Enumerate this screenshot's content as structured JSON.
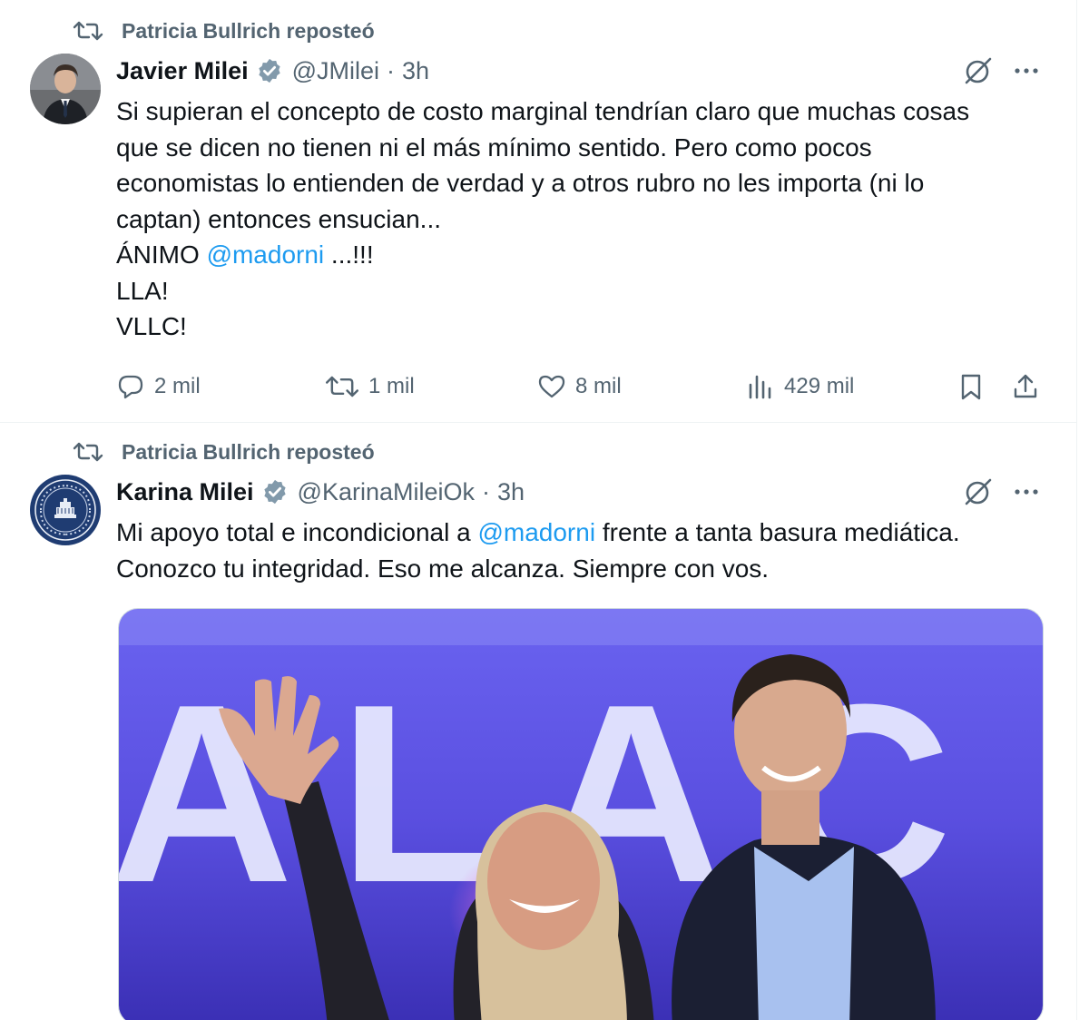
{
  "tweets": [
    {
      "repost_label": "Patricia Bullrich reposteó",
      "author_name": "Javier Milei",
      "handle": "@JMilei",
      "separator": "·",
      "time": "3h",
      "lines": [
        "Si supieran el concepto de costo marginal tendrían claro que muchas cosas",
        "que se dicen no tienen ni el más mínimo sentido. Pero como pocos",
        "economistas lo entienden de verdad y a otros rubro no les importa (ni lo",
        "captan) entonces ensucian..."
      ],
      "animo_prefix": "ÁNIMO ",
      "animo_mention": "@madorni",
      "animo_suffix": " ...!!!",
      "line_lla": "LLA!",
      "line_vllc": "VLLC!",
      "stats": {
        "replies": "2 mil",
        "reposts": "1 mil",
        "likes": "8 mil",
        "views": "429 mil"
      }
    },
    {
      "repost_label": "Patricia Bullrich reposteó",
      "author_name": "Karina Milei",
      "handle": "@KarinaMileiOk",
      "separator": "·",
      "time": "3h",
      "line1_prefix": "Mi apoyo total e incondicional a ",
      "line1_mention": "@madorni",
      "line1_suffix": " frente a tanta basura mediática.",
      "line2": "Conozco tu integridad. Eso me alcanza. Siempre con vos.",
      "media_backdrop_text": "ALAC"
    }
  ],
  "colors": {
    "accent": "#1d9bf0",
    "secondary_text": "#536471",
    "verified_badge": "#829aab"
  },
  "icons": [
    "repost-icon",
    "verified-icon",
    "grok-icon",
    "more-icon",
    "reply-icon",
    "like-icon",
    "views-icon",
    "bookmark-icon",
    "share-icon"
  ]
}
